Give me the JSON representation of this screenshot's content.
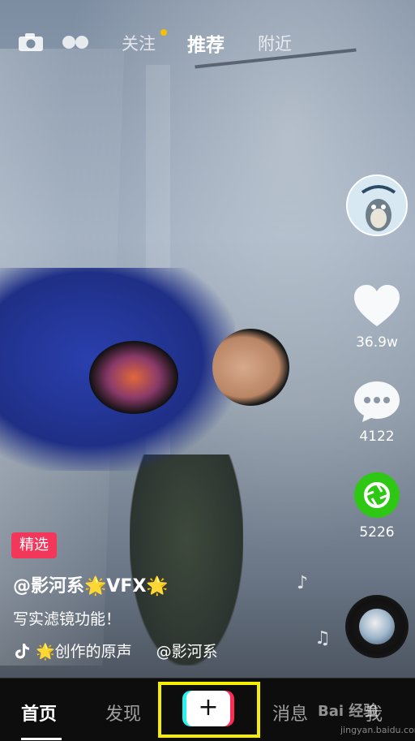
{
  "top_tabs": [
    {
      "label": "关注"
    },
    {
      "label": "推荐"
    },
    {
      "label": "附近"
    }
  ],
  "side": {
    "likes": "36.9w",
    "comments": "4122",
    "shares": "5226"
  },
  "info": {
    "badge": "精选",
    "author": "@影河系🌟VFX🌟",
    "caption": "写实滤镜功能！",
    "music": "🌟创作的原声",
    "music_author": "@影河系"
  },
  "nav": {
    "home": "首页",
    "discover": "发现",
    "plus": "+",
    "messages": "消息",
    "me": "我"
  },
  "watermark": {
    "brand": "Bai 经验",
    "url": "jingyan.baidu.com"
  },
  "colors": {
    "badge": "#f2375a",
    "share_green": "#2ec714",
    "tab_dot": "#f4c200",
    "highlight": "#f5ee00",
    "plus_cyan": "#25f4ee",
    "plus_red": "#fe2c55"
  }
}
